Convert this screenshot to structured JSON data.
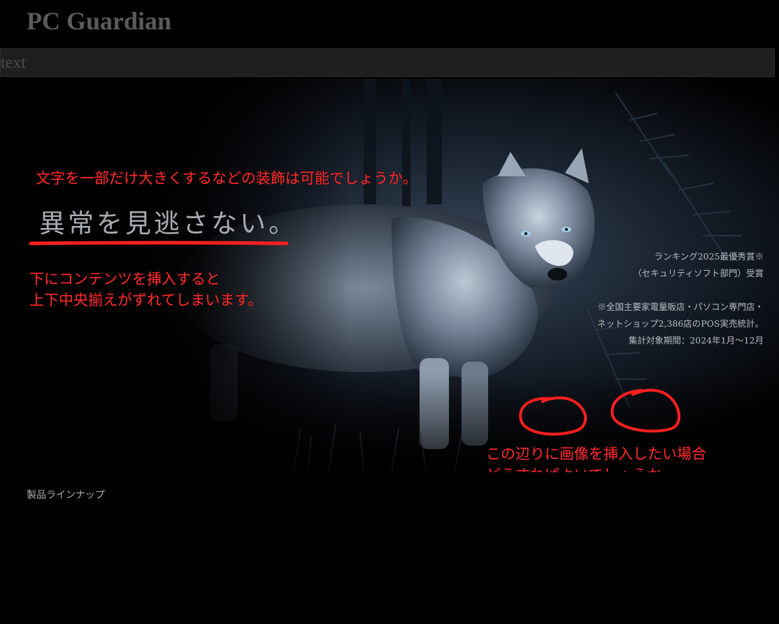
{
  "header": {
    "title": "PC Guardian"
  },
  "search_bar": {
    "value": "text"
  },
  "hero": {
    "headline": "異常を見逃さない。",
    "award_lines": [
      "ランキング2025最優秀賞※",
      "（セキュリティソフト部門）受賞",
      "",
      "※全国主要家電量販店・パソコン専門店・",
      "ネットショップ2,386店のPOS実売統計。",
      "集計対象期間：2024年1月〜12月"
    ]
  },
  "annotations": {
    "note_1": "文字を一部だけ大きくするなどの装飾は可能でしょうか。",
    "note_2_line_1": "下にコンテンツを挿入すると",
    "note_2_line_2": "上下中央揃えがずれてしまいます。",
    "note_3_line_1": "この辺りに画像を挿入したい場合",
    "note_3_line_2": "どうすればよいでしょうか。",
    "color": "#ff2a2a"
  },
  "section": {
    "lineup_label": "製品ラインナップ"
  },
  "colors": {
    "background": "#000000",
    "title_text": "#5b5b5b",
    "bar_background": "#1f1f1f",
    "hero_text": "#a8acb2"
  }
}
